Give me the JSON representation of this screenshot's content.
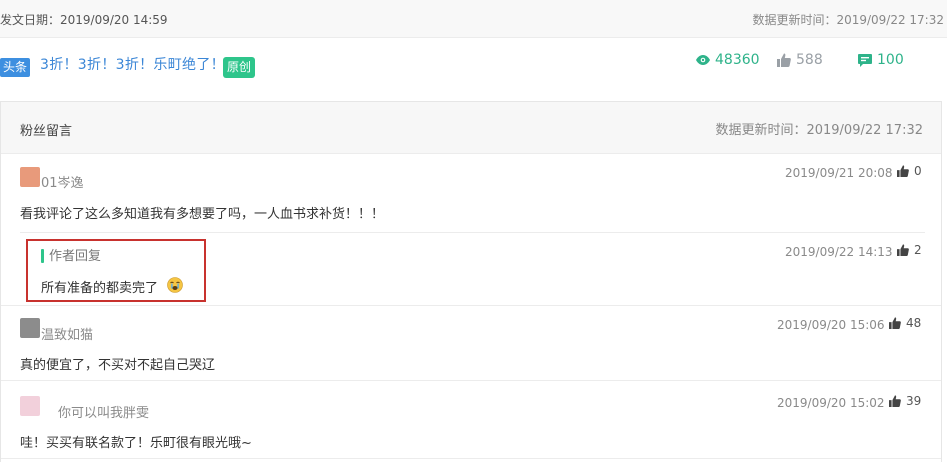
{
  "header": {
    "publish_date": "发文日期：2019/09/20 14:59",
    "updated": "数据更新时间：2019/09/22 17:32"
  },
  "article": {
    "badge": "头条",
    "title": "3折！3折！3折！乐町绝了！",
    "original_badge": "原创",
    "views": "48360",
    "likes": "588",
    "comments": "100"
  },
  "comments_section": {
    "title": "粉丝留言",
    "updated": "数据更新时间：2019/09/22 17:32",
    "comments": [
      {
        "user": "01岑逸",
        "text": "看我评论了这么多知道我有多想要了吗，一人血书求补货！！！",
        "time": "2019/09/21 20:08",
        "likes": "0"
      },
      {
        "user": "作者回复",
        "text": "所有准备的都卖完了",
        "time": "2019/09/22 14:13",
        "likes": "2"
      },
      {
        "user": "温致如猫",
        "text": "真的便宜了，不买对不起自己哭辽",
        "time": "2019/09/20 15:06",
        "likes": "48"
      },
      {
        "user": "你可以叫我胖雯",
        "text": "哇！买买有联名款了！乐町很有眼光哦~",
        "time": "2019/09/20 15:02",
        "likes": "39"
      }
    ]
  },
  "colors": {
    "accent_green": "#2ec58b",
    "accent_blue": "#3d8fe0",
    "highlight_red": "#c8322e"
  },
  "icons": [
    "eye-icon",
    "thumbs-up-icon",
    "comment-icon",
    "crying-emoji-icon",
    "avatar-image"
  ]
}
